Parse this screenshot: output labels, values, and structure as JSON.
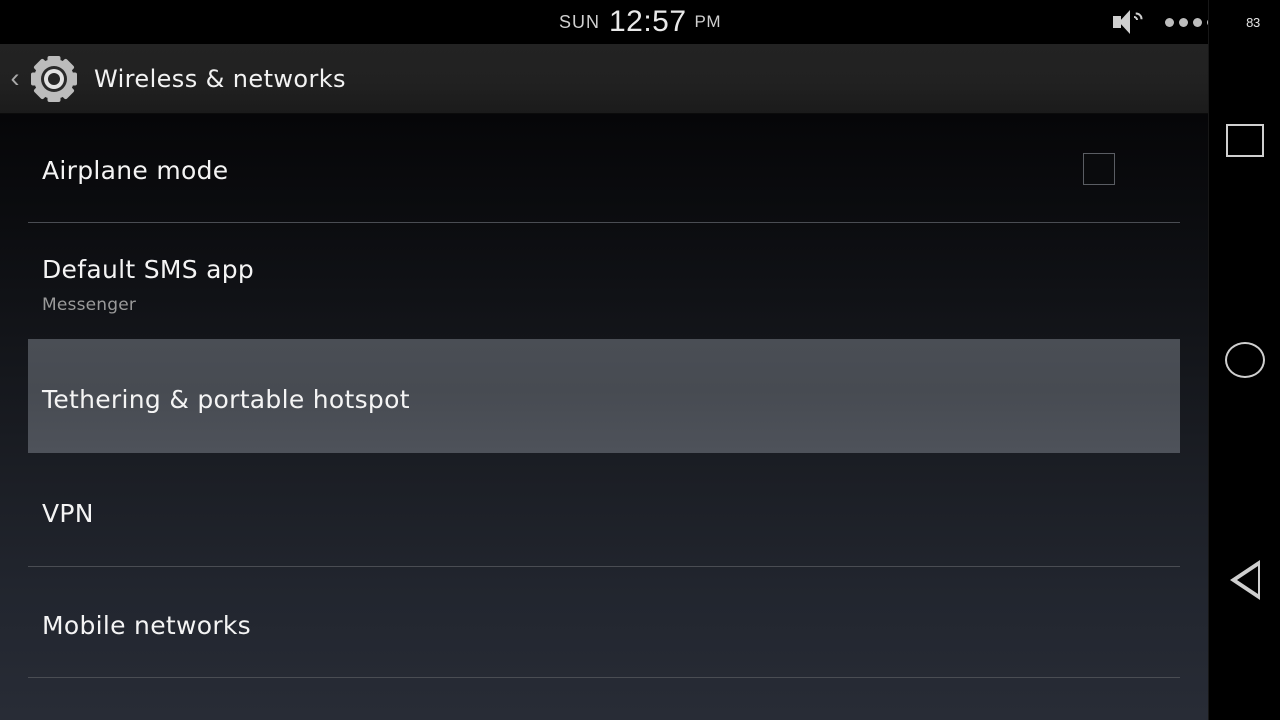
{
  "status_bar": {
    "day_of_week": "SUN",
    "time": "12:57",
    "meridiem": "PM",
    "volume_icon": "speaker-volume-icon",
    "signal_dots_icon": "signal-dots-icon",
    "battery_level": "83"
  },
  "title_bar": {
    "back_icon": "‹",
    "settings_icon": "gear-icon",
    "title": "Wireless & networks"
  },
  "list": {
    "items": [
      {
        "label": "Airplane mode",
        "subtitle": "",
        "control": "checkbox",
        "checked": false,
        "highlighted": false
      },
      {
        "label": "Default SMS app",
        "subtitle": "Messenger",
        "control": "none",
        "checked": false,
        "highlighted": false
      },
      {
        "label": "Tethering & portable hotspot",
        "subtitle": "",
        "control": "none",
        "checked": false,
        "highlighted": true
      },
      {
        "label": "VPN",
        "subtitle": "",
        "control": "none",
        "checked": false,
        "highlighted": false
      },
      {
        "label": "Mobile networks",
        "subtitle": "",
        "control": "none",
        "checked": false,
        "highlighted": false
      }
    ]
  },
  "nav_bar": {
    "recents_label": "recents",
    "home_label": "home",
    "back_label": "back"
  },
  "colors": {
    "accent_text": "#f4f4f4",
    "subtitle_text": "#9a9a9a",
    "divider": "#4a4d53",
    "highlight_top": "#4a4e55",
    "highlight_bottom": "#4e525a",
    "title_bar_bg": "#222222",
    "nav_icon": "#cfcfcf"
  }
}
